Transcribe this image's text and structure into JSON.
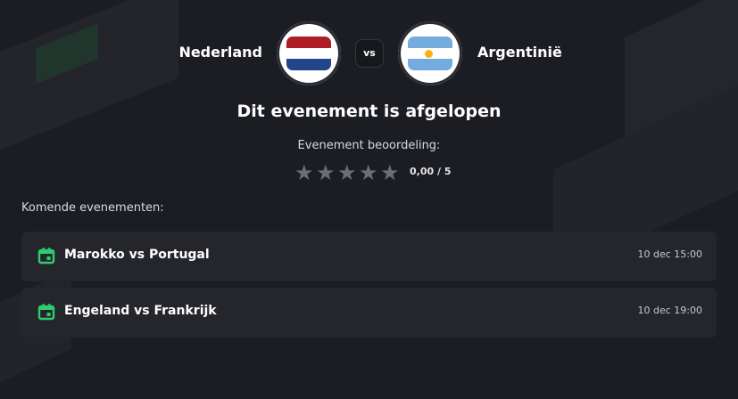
{
  "match": {
    "home_team": "Nederland",
    "away_team": "Argentinië",
    "vs_label": "vs",
    "home_flag_icon": "netherlands-flag-icon",
    "away_flag_icon": "argentina-flag-icon"
  },
  "status": {
    "title": "Dit evenement is afgelopen",
    "rating_label": "Evenement beoordeling:",
    "rating_value": "0,00 / 5",
    "rating": 0,
    "stars_max": 5
  },
  "upcoming": {
    "title": "Komende evenementen:",
    "events": [
      {
        "title": "Marokko vs Portugal",
        "time": "10 dec 15:00",
        "icon": "calendar-icon"
      },
      {
        "title": "Engeland vs Frankrijk",
        "time": "10 dec 19:00",
        "icon": "calendar-icon"
      }
    ]
  },
  "colors": {
    "background": "#1c1d22",
    "card": "#25262c",
    "accent_green": "#2ecc71",
    "star_empty": "#6d6e73"
  }
}
